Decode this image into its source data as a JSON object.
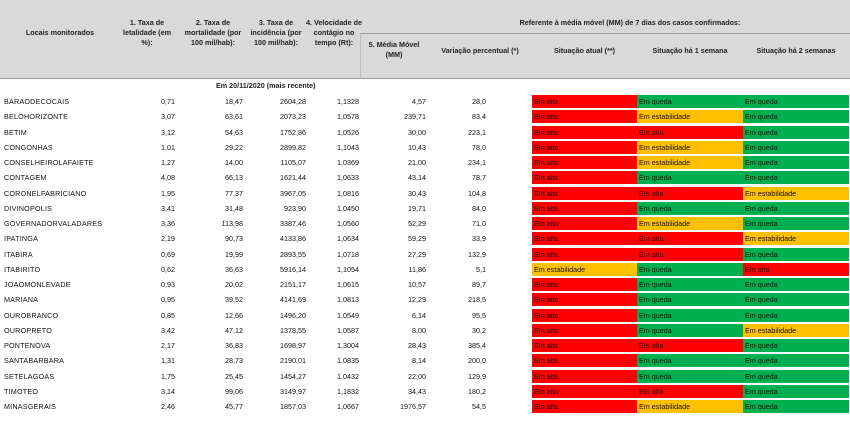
{
  "headers": {
    "locais": "Locais monitorados",
    "taxa_letalidade": "1. Taxa de letalidade (em %):",
    "taxa_mortalidade": "2. Taxa de mortalidade (por 100 mil/hab):",
    "taxa_incidencia": "3. Taxa de incidência (por 100 mil/hab):",
    "velocidade": "4. Velocidade de contágio no tempo (Rt):",
    "referente": "Referente à média móvel (MM) de 7 dias  dos casos confirmados:",
    "media_movel": "5. Média Móvel (MM)",
    "variacao": "Variação percentual (*)",
    "situacao_atual": "Situação atual (**)",
    "situacao_1sem": "Situação há 1 semana",
    "situacao_2sem": "Situação há 2 semanas"
  },
  "date_label": "Em 20/11/2020 (mais recente)",
  "status_colors": {
    "alta": "#ff0000",
    "queda": "#00b050",
    "estabilidade": "#ffc000"
  },
  "rows": [
    {
      "local": "BARAODECOCAIS",
      "letalidade": "0,71",
      "mortalidade": "18,47",
      "incidencia": "2604,28",
      "rt": "1,1328",
      "mm": "4,57",
      "variacao": "28,0",
      "s0": "Em alta",
      "s1": "Em queda",
      "s2": "Em queda"
    },
    {
      "local": "BELOHORIZONTE",
      "letalidade": "3,07",
      "mortalidade": "63,61",
      "incidencia": "2073,23",
      "rt": "1,0578",
      "mm": "239,71",
      "variacao": "83,4",
      "s0": "Em alta",
      "s1": "Em estabilidade",
      "s2": "Em queda"
    },
    {
      "local": "BETIM",
      "letalidade": "3,12",
      "mortalidade": "54,63",
      "incidencia": "1752,86",
      "rt": "1,0526",
      "mm": "30,00",
      "variacao": "223,1",
      "s0": "Em alta",
      "s1": "Em alta",
      "s2": "Em queda"
    },
    {
      "local": "CONGONHAS",
      "letalidade": "1,01",
      "mortalidade": "29,22",
      "incidencia": "2899,82",
      "rt": "1,1043",
      "mm": "10,43",
      "variacao": "78,0",
      "s0": "Em alta",
      "s1": "Em estabilidade",
      "s2": "Em queda"
    },
    {
      "local": "CONSELHEIROLAFAIETE",
      "letalidade": "1,27",
      "mortalidade": "14,00",
      "incidencia": "1105,07",
      "rt": "1,0369",
      "mm": "21,00",
      "variacao": "234,1",
      "s0": "Em alta",
      "s1": "Em estabilidade",
      "s2": "Em queda"
    },
    {
      "local": "CONTAGEM",
      "letalidade": "4,08",
      "mortalidade": "66,13",
      "incidencia": "1621,44",
      "rt": "1,0633",
      "mm": "43,14",
      "variacao": "78,7",
      "s0": "Em alta",
      "s1": "Em queda",
      "s2": "Em queda"
    },
    {
      "local": "CORONELFABRICIANO",
      "letalidade": "1,95",
      "mortalidade": "77,37",
      "incidencia": "3967,05",
      "rt": "1,0816",
      "mm": "30,43",
      "variacao": "104,8",
      "s0": "Em alta",
      "s1": "Em alta",
      "s2": "Em estabilidade"
    },
    {
      "local": "DIVINOPOLIS",
      "letalidade": "3,41",
      "mortalidade": "31,48",
      "incidencia": "923,90",
      "rt": "1,0450",
      "mm": "19,71",
      "variacao": "84,0",
      "s0": "Em alta",
      "s1": "Em queda",
      "s2": "Em queda"
    },
    {
      "local": "GOVERNADORVALADARES",
      "letalidade": "3,36",
      "mortalidade": "113,98",
      "incidencia": "3387,46",
      "rt": "1,0560",
      "mm": "52,29",
      "variacao": "71,0",
      "s0": "Em alta",
      "s1": "Em estabilidade",
      "s2": "Em queda"
    },
    {
      "local": "IPATINGA",
      "letalidade": "2,19",
      "mortalidade": "90,73",
      "incidencia": "4133,86",
      "rt": "1,0634",
      "mm": "59,29",
      "variacao": "33,9",
      "s0": "Em alta",
      "s1": "Em alta",
      "s2": "Em estabilidade"
    },
    {
      "local": "ITABIRA",
      "letalidade": "0,69",
      "mortalidade": "19,99",
      "incidencia": "2893,55",
      "rt": "1,0718",
      "mm": "27,29",
      "variacao": "132,9",
      "s0": "Em alta",
      "s1": "Em alta",
      "s2": "Em queda"
    },
    {
      "local": "ITABIRITO",
      "letalidade": "0,62",
      "mortalidade": "36,63",
      "incidencia": "5916,14",
      "rt": "1,1054",
      "mm": "11,86",
      "variacao": "5,1",
      "s0": "Em estabilidade",
      "s1": "Em queda",
      "s2": "Em alta"
    },
    {
      "local": "JOAOMONLEVADE",
      "letalidade": "0,93",
      "mortalidade": "20,02",
      "incidencia": "2151,17",
      "rt": "1,0615",
      "mm": "10,57",
      "variacao": "89,7",
      "s0": "Em alta",
      "s1": "Em queda",
      "s2": "Em queda"
    },
    {
      "local": "MARIANA",
      "letalidade": "0,95",
      "mortalidade": "39,52",
      "incidencia": "4141,69",
      "rt": "1,0813",
      "mm": "12,29",
      "variacao": "218,5",
      "s0": "Em alta",
      "s1": "Em queda",
      "s2": "Em queda"
    },
    {
      "local": "OUROBRANCO",
      "letalidade": "0,85",
      "mortalidade": "12,66",
      "incidencia": "1496,20",
      "rt": "1,0549",
      "mm": "6,14",
      "variacao": "95,5",
      "s0": "Em alta",
      "s1": "Em queda",
      "s2": "Em queda"
    },
    {
      "local": "OUROPRETO",
      "letalidade": "3,42",
      "mortalidade": "47,12",
      "incidencia": "1378,55",
      "rt": "1,0587",
      "mm": "8,00",
      "variacao": "30,2",
      "s0": "Em alta",
      "s1": "Em queda",
      "s2": "Em estabilidade"
    },
    {
      "local": "PONTENOVA",
      "letalidade": "2,17",
      "mortalidade": "36,83",
      "incidencia": "1698,97",
      "rt": "1,3004",
      "mm": "28,43",
      "variacao": "385,4",
      "s0": "Em alta",
      "s1": "Em alta",
      "s2": "Em queda"
    },
    {
      "local": "SANTABARBARA",
      "letalidade": "1,31",
      "mortalidade": "28,73",
      "incidencia": "2190,01",
      "rt": "1,0835",
      "mm": "8,14",
      "variacao": "200,0",
      "s0": "Em alta",
      "s1": "Em queda",
      "s2": "Em queda"
    },
    {
      "local": "SETELAGOAS",
      "letalidade": "1,75",
      "mortalidade": "25,45",
      "incidencia": "1454,27",
      "rt": "1,0432",
      "mm": "22,00",
      "variacao": "129,9",
      "s0": "Em alta",
      "s1": "Em queda",
      "s2": "Em queda"
    },
    {
      "local": "TIMOTEO",
      "letalidade": "3,14",
      "mortalidade": "99,06",
      "incidencia": "3149,97",
      "rt": "1,1832",
      "mm": "34,43",
      "variacao": "180,2",
      "s0": "Em alta",
      "s1": "Em alta",
      "s2": "Em queda"
    },
    {
      "local": "MINASGERAIS",
      "letalidade": "2,46",
      "mortalidade": "45,77",
      "incidencia": "1857,03",
      "rt": "1,0667",
      "mm": "1976,57",
      "variacao": "54,5",
      "s0": "Em alta",
      "s1": "Em estabilidade",
      "s2": "Em queda"
    }
  ]
}
